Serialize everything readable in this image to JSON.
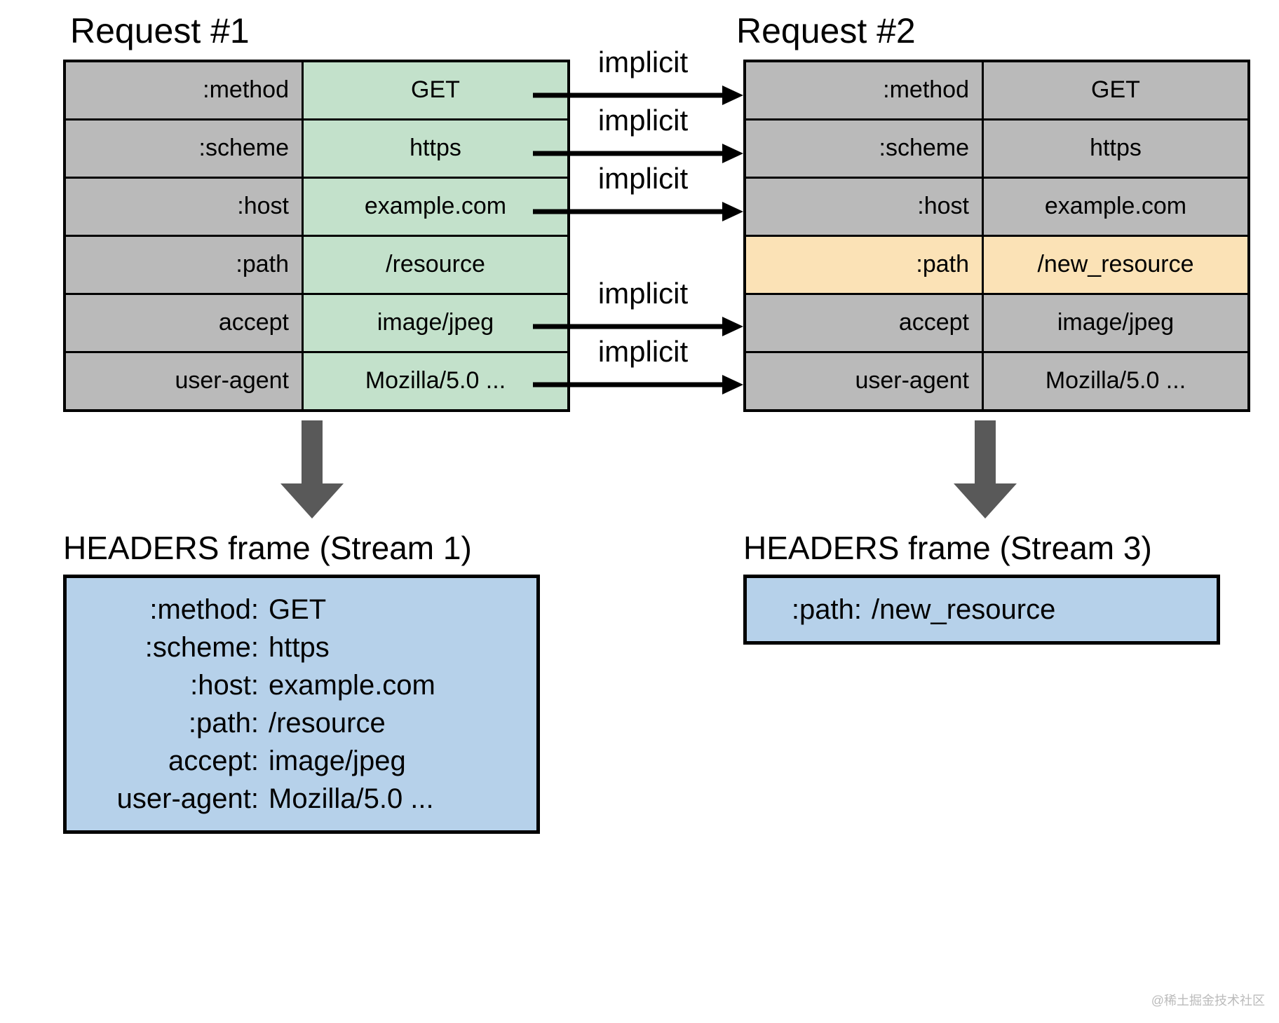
{
  "colors": {
    "gray": "#bababa",
    "green": "#c3e1cb",
    "yellow": "#fbe2b6",
    "blue": "#b6d1ea",
    "arrow": "#595959"
  },
  "arrow_label": "implicit",
  "request1": {
    "title": "Request #1",
    "rows": [
      {
        "key": ":method",
        "value": "GET",
        "value_bg": "green",
        "implicit": true
      },
      {
        "key": ":scheme",
        "value": "https",
        "value_bg": "green",
        "implicit": true
      },
      {
        "key": ":host",
        "value": "example.com",
        "value_bg": "green",
        "implicit": true
      },
      {
        "key": ":path",
        "value": "/resource",
        "value_bg": "green",
        "implicit": false
      },
      {
        "key": "accept",
        "value": "image/jpeg",
        "value_bg": "green",
        "implicit": true
      },
      {
        "key": "user-agent",
        "value": "Mozilla/5.0 ...",
        "value_bg": "green",
        "implicit": true
      }
    ]
  },
  "request2": {
    "title": "Request #2",
    "rows": [
      {
        "key": ":method",
        "value": "GET",
        "value_bg": "gray"
      },
      {
        "key": ":scheme",
        "value": "https",
        "value_bg": "gray"
      },
      {
        "key": ":host",
        "value": "example.com",
        "value_bg": "gray"
      },
      {
        "key": ":path",
        "value": "/new_resource",
        "value_bg": "yellow"
      },
      {
        "key": "accept",
        "value": "image/jpeg",
        "value_bg": "gray"
      },
      {
        "key": "user-agent",
        "value": "Mozilla/5.0 ...",
        "value_bg": "gray"
      }
    ]
  },
  "frame1": {
    "title": "HEADERS frame (Stream 1)",
    "lines": [
      {
        "key": ":method:",
        "value": "GET"
      },
      {
        "key": ":scheme:",
        "value": "https"
      },
      {
        "key": ":host:",
        "value": "example.com"
      },
      {
        "key": ":path:",
        "value": "/resource"
      },
      {
        "key": "accept:",
        "value": "image/jpeg"
      },
      {
        "key": "user-agent:",
        "value": "Mozilla/5.0 ..."
      }
    ]
  },
  "frame2": {
    "title": "HEADERS frame (Stream 3)",
    "lines": [
      {
        "key": ":path:",
        "value": "/new_resource"
      }
    ]
  },
  "watermark": "@稀土掘金技术社区"
}
